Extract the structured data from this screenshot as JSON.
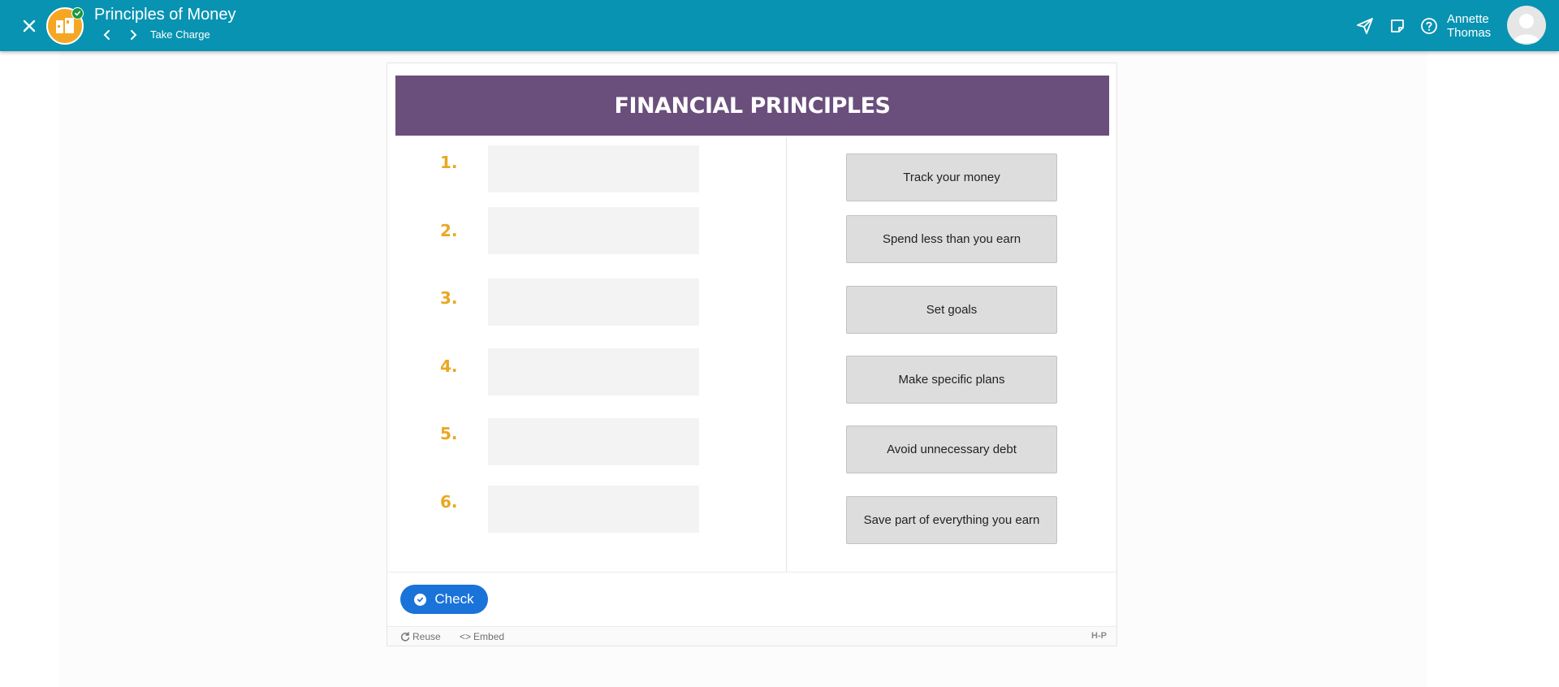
{
  "header": {
    "course_title": "Principles of Money",
    "section": "Take Charge",
    "user": {
      "first": "Annette",
      "last": "Thomas"
    },
    "icons": [
      "close-icon",
      "course-logo-icon",
      "chevron-left-icon",
      "chevron-right-icon",
      "paper-plane-icon",
      "note-icon",
      "help-icon",
      "avatar-icon"
    ]
  },
  "activity": {
    "title": "FINANCIAL PRINCIPLES",
    "numbers": [
      "1.",
      "2.",
      "3.",
      "4.",
      "5.",
      "6."
    ],
    "draggables": [
      "Track your money",
      "Spend less than you earn",
      "Set goals",
      "Make specific plans",
      "Avoid unnecessary debt",
      "Save part of everything you earn"
    ],
    "check_label": "Check"
  },
  "footer": {
    "reuse_label": "Reuse",
    "embed_label": "Embed",
    "logo_text": "H-P"
  },
  "colors": {
    "topbar": "#0993b2",
    "banner": "#6a4e7c",
    "numbers": "#e9a823",
    "check_button": "#1a73d9"
  }
}
